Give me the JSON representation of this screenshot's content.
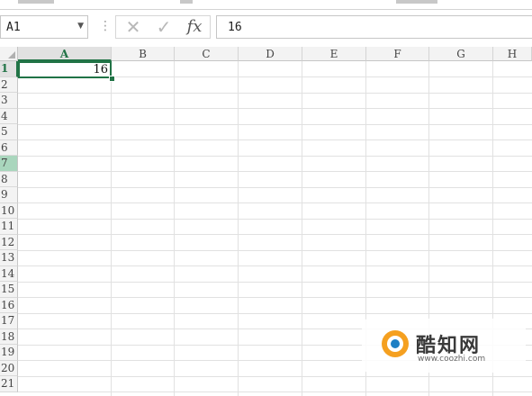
{
  "formula_bar": {
    "name_box": "A1",
    "cancel_icon": "✕",
    "enter_icon": "✓",
    "fx_label": "fx",
    "formula_value": "16",
    "separator": "⋮"
  },
  "columns": [
    "A",
    "B",
    "C",
    "D",
    "E",
    "F",
    "G",
    "H"
  ],
  "rows": [
    "1",
    "2",
    "3",
    "4",
    "5",
    "6",
    "7",
    "8",
    "9",
    "10",
    "11",
    "12",
    "13",
    "14",
    "15",
    "16",
    "17",
    "18",
    "19",
    "20",
    "21"
  ],
  "active_cell": {
    "ref": "A1",
    "value": "16"
  },
  "highlighted_row": "7",
  "colors": {
    "excel_green": "#217346",
    "row_highlight": "#a9d6bd"
  },
  "watermark": {
    "title": "酷知网",
    "url": "www.coozhi.com"
  }
}
